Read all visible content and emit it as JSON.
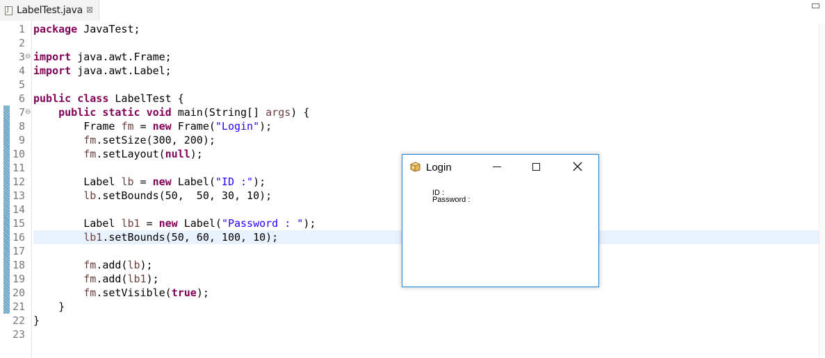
{
  "tab": {
    "title": "LabelTest.java",
    "close_glyph": "⊠"
  },
  "code_lines": [
    {
      "num": "1",
      "fold": "",
      "parts": [
        {
          "t": "kw",
          "v": "package"
        },
        {
          "t": "",
          "v": " JavaTest;"
        }
      ]
    },
    {
      "num": "2",
      "fold": "",
      "parts": []
    },
    {
      "num": "3",
      "fold": "⊖",
      "parts": [
        {
          "t": "kw",
          "v": "import"
        },
        {
          "t": "",
          "v": " java.awt.Frame;"
        }
      ]
    },
    {
      "num": "4",
      "fold": "",
      "parts": [
        {
          "t": "kw",
          "v": "import"
        },
        {
          "t": "",
          "v": " java.awt.Label;"
        }
      ]
    },
    {
      "num": "5",
      "fold": "",
      "parts": []
    },
    {
      "num": "6",
      "fold": "",
      "parts": [
        {
          "t": "kw",
          "v": "public"
        },
        {
          "t": "",
          "v": " "
        },
        {
          "t": "kw",
          "v": "class"
        },
        {
          "t": "",
          "v": " LabelTest {"
        }
      ]
    },
    {
      "num": "7",
      "fold": "⊖",
      "parts": [
        {
          "t": "",
          "v": "    "
        },
        {
          "t": "kw",
          "v": "public"
        },
        {
          "t": "",
          "v": " "
        },
        {
          "t": "kw",
          "v": "static"
        },
        {
          "t": "",
          "v": " "
        },
        {
          "t": "kw",
          "v": "void"
        },
        {
          "t": "",
          "v": " main(String[] "
        },
        {
          "t": "loc",
          "v": "args"
        },
        {
          "t": "",
          "v": ") {"
        }
      ]
    },
    {
      "num": "8",
      "fold": "",
      "parts": [
        {
          "t": "",
          "v": "        Frame "
        },
        {
          "t": "loc",
          "v": "fm"
        },
        {
          "t": "",
          "v": " = "
        },
        {
          "t": "kw",
          "v": "new"
        },
        {
          "t": "",
          "v": " Frame("
        },
        {
          "t": "str",
          "v": "\"Login\""
        },
        {
          "t": "",
          "v": ");"
        }
      ]
    },
    {
      "num": "9",
      "fold": "",
      "parts": [
        {
          "t": "",
          "v": "        "
        },
        {
          "t": "loc",
          "v": "fm"
        },
        {
          "t": "",
          "v": ".setSize(300, 200);"
        }
      ]
    },
    {
      "num": "10",
      "fold": "",
      "parts": [
        {
          "t": "",
          "v": "        "
        },
        {
          "t": "loc",
          "v": "fm"
        },
        {
          "t": "",
          "v": ".setLayout("
        },
        {
          "t": "kw",
          "v": "null"
        },
        {
          "t": "",
          "v": ");"
        }
      ]
    },
    {
      "num": "11",
      "fold": "",
      "parts": []
    },
    {
      "num": "12",
      "fold": "",
      "parts": [
        {
          "t": "",
          "v": "        Label "
        },
        {
          "t": "loc",
          "v": "lb"
        },
        {
          "t": "",
          "v": " = "
        },
        {
          "t": "kw",
          "v": "new"
        },
        {
          "t": "",
          "v": " Label("
        },
        {
          "t": "str",
          "v": "\"ID :\""
        },
        {
          "t": "",
          "v": ");"
        }
      ]
    },
    {
      "num": "13",
      "fold": "",
      "parts": [
        {
          "t": "",
          "v": "        "
        },
        {
          "t": "loc",
          "v": "lb"
        },
        {
          "t": "",
          "v": ".setBounds(50,  50, 30, 10);"
        }
      ]
    },
    {
      "num": "14",
      "fold": "",
      "parts": []
    },
    {
      "num": "15",
      "fold": "",
      "parts": [
        {
          "t": "",
          "v": "        Label "
        },
        {
          "t": "loc",
          "v": "lb1"
        },
        {
          "t": "",
          "v": " = "
        },
        {
          "t": "kw",
          "v": "new"
        },
        {
          "t": "",
          "v": " Label("
        },
        {
          "t": "str",
          "v": "\"Password : \""
        },
        {
          "t": "",
          "v": ");"
        }
      ]
    },
    {
      "num": "16",
      "fold": "",
      "parts": [
        {
          "t": "",
          "v": "        "
        },
        {
          "t": "loc",
          "v": "lb1"
        },
        {
          "t": "",
          "v": ".setBounds(50, 60, 100, 10);"
        }
      ]
    },
    {
      "num": "17",
      "fold": "",
      "parts": []
    },
    {
      "num": "18",
      "fold": "",
      "parts": [
        {
          "t": "",
          "v": "        "
        },
        {
          "t": "loc",
          "v": "fm"
        },
        {
          "t": "",
          "v": ".add("
        },
        {
          "t": "loc",
          "v": "lb"
        },
        {
          "t": "",
          "v": ");"
        }
      ]
    },
    {
      "num": "19",
      "fold": "",
      "parts": [
        {
          "t": "",
          "v": "        "
        },
        {
          "t": "loc",
          "v": "fm"
        },
        {
          "t": "",
          "v": ".add("
        },
        {
          "t": "loc",
          "v": "lb1"
        },
        {
          "t": "",
          "v": ");"
        }
      ]
    },
    {
      "num": "20",
      "fold": "",
      "parts": [
        {
          "t": "",
          "v": "        "
        },
        {
          "t": "loc",
          "v": "fm"
        },
        {
          "t": "",
          "v": ".setVisible("
        },
        {
          "t": "kw",
          "v": "true"
        },
        {
          "t": "",
          "v": ");"
        }
      ]
    },
    {
      "num": "21",
      "fold": "",
      "parts": [
        {
          "t": "",
          "v": "    }"
        }
      ]
    },
    {
      "num": "22",
      "fold": "",
      "parts": [
        {
          "t": "",
          "v": "}"
        }
      ]
    },
    {
      "num": "23",
      "fold": "",
      "parts": []
    }
  ],
  "login_window": {
    "title": "Login",
    "id_label": "ID :",
    "password_label": "Password :"
  },
  "colors": {
    "keyword": "#7f0055",
    "string": "#2a00ff",
    "local_variable": "#6a3e3e",
    "current_line": "#e8f2fe",
    "window_border": "#1883d7"
  }
}
